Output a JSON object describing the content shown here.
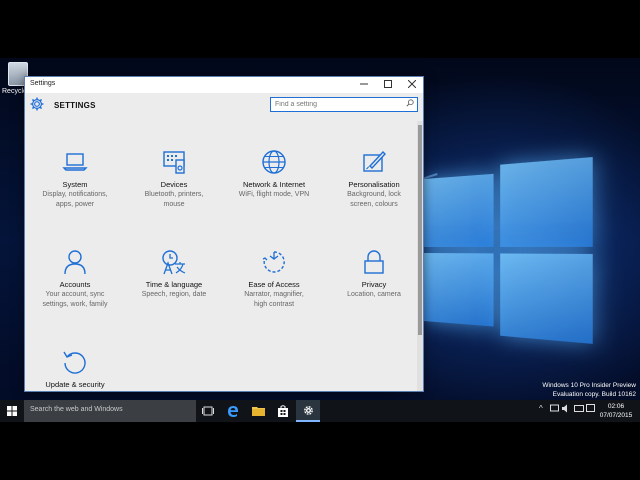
{
  "desktop": {
    "recycle_bin_label": "Recycle Bin",
    "watermark_line1": "Windows 10 Pro Insider Preview",
    "watermark_line2": "Evaluation copy. Build 10162"
  },
  "window": {
    "title": "Settings",
    "minimize_icon": "minimize-icon",
    "maximize_icon": "maximize-icon",
    "close_icon": "close-icon"
  },
  "header": {
    "title": "SETTINGS",
    "search_placeholder": "Find a setting"
  },
  "categories": [
    {
      "name": "System",
      "desc": "Display, notifications,\napps, power",
      "icon": "laptop-icon"
    },
    {
      "name": "Devices",
      "desc": "Bluetooth, printers,\nmouse",
      "icon": "devices-icon"
    },
    {
      "name": "Network & Internet",
      "desc": "WiFi, flight mode, VPN",
      "icon": "globe-icon"
    },
    {
      "name": "Personalisation",
      "desc": "Background, lock\nscreen, colours",
      "icon": "paint-icon"
    },
    {
      "name": "Accounts",
      "desc": "Your account, sync\nsettings, work, family",
      "icon": "person-icon"
    },
    {
      "name": "Time & language",
      "desc": "Speech, region, date",
      "icon": "time-language-icon"
    },
    {
      "name": "Ease of Access",
      "desc": "Narrator, magnifier,\nhigh contrast",
      "icon": "ease-of-access-icon"
    },
    {
      "name": "Privacy",
      "desc": "Location, camera",
      "icon": "lock-icon"
    },
    {
      "name": "Update & security",
      "desc": "",
      "icon": "update-icon"
    }
  ],
  "taskbar": {
    "search_placeholder": "Search the web and Windows",
    "clock_time": "02:06",
    "clock_date": "07/07/2015"
  },
  "colors": {
    "accent": "#1e6fd6",
    "window_bg": "#ececec",
    "taskbar_bg": "#101418"
  }
}
